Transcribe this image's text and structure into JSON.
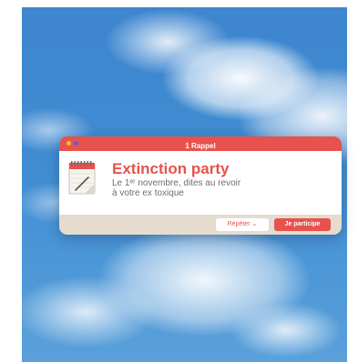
{
  "colors": {
    "accent": "#e8524d",
    "footer_bg": "#e5dccf",
    "sky": "#3f8bd1",
    "dot_1": "#f5b831",
    "dot_2": "#5a5fe0"
  },
  "notification": {
    "header_title": "1 Rappel",
    "icon": "calendar-icon",
    "title": "Extinction party",
    "body_line_1": "Le 1ᵉʳ novembre, dites au revoir",
    "body_line_2": "à votre ex toxique",
    "repeat_label": "Répéter",
    "repeat_chevron": "⌄",
    "action_label": "Je participe"
  }
}
